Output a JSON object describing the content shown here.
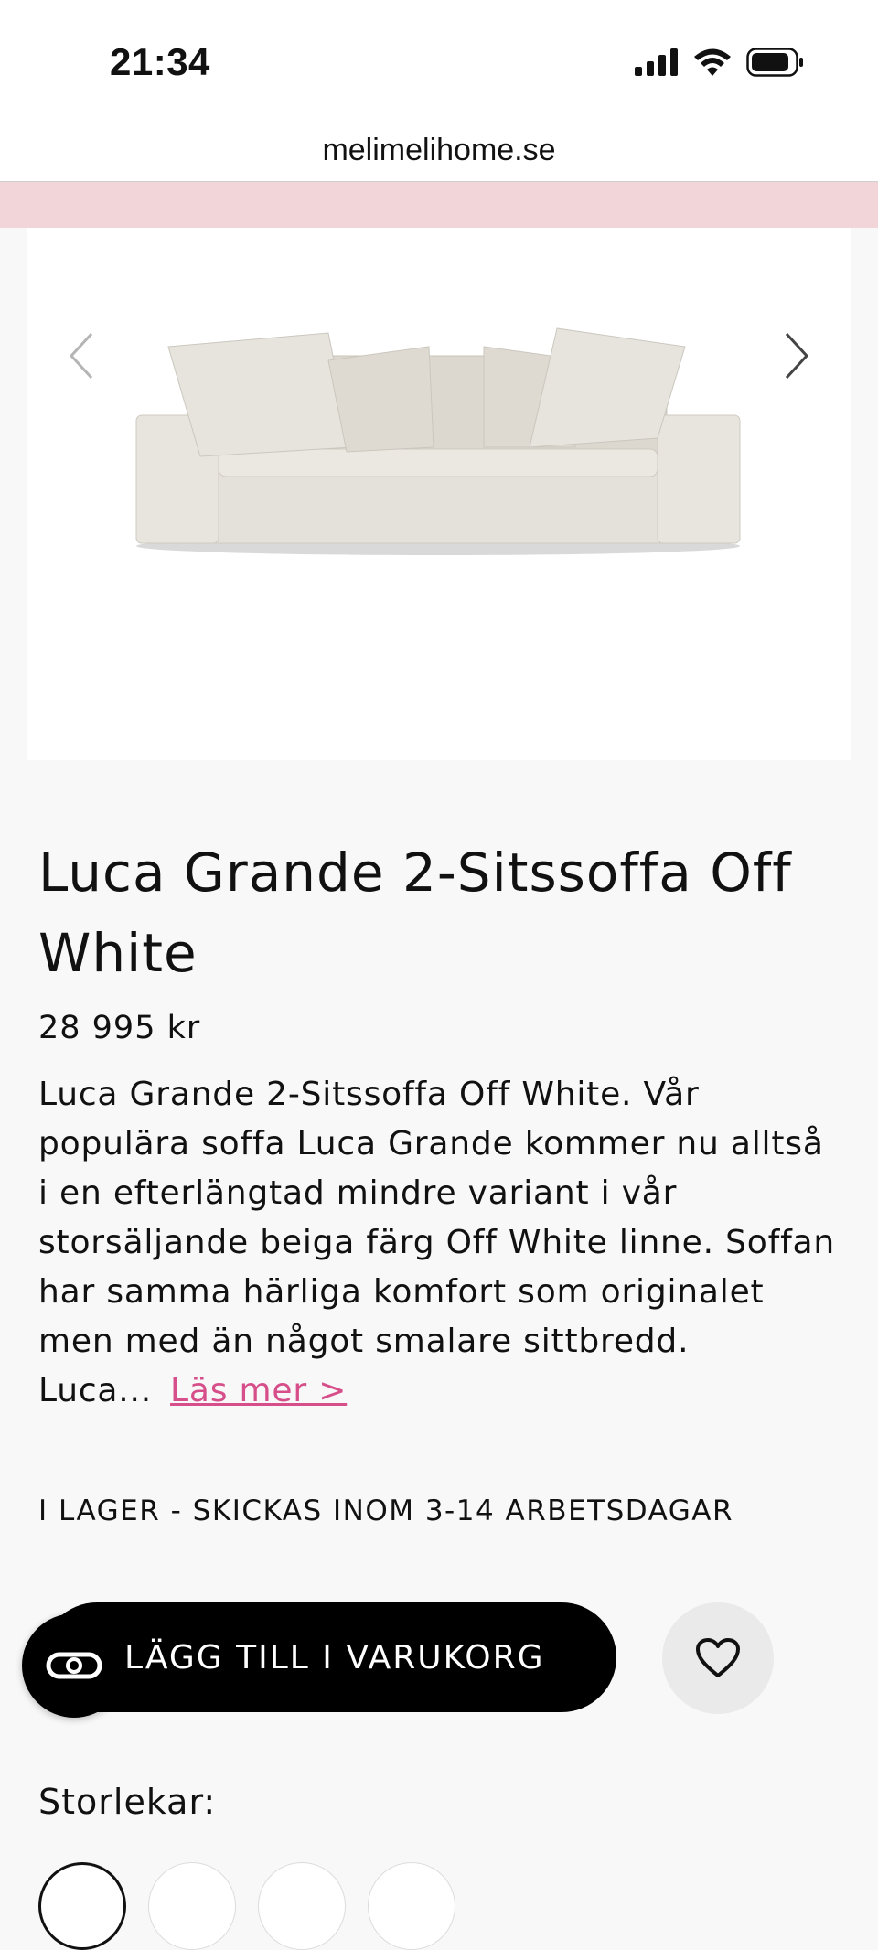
{
  "status_bar": {
    "time": "21:34",
    "icons": [
      "signal-icon",
      "wifi-icon",
      "battery-icon"
    ]
  },
  "browser": {
    "url": "melimelihome.se"
  },
  "colors": {
    "promo_bar": "#f1d5d8",
    "accent_link": "#d64f8a",
    "cart_button": "#000000"
  },
  "gallery": {
    "prev_icon": "chevron-left-icon",
    "next_icon": "chevron-right-icon",
    "image": "sofa-image"
  },
  "product": {
    "title": "Luca Grande 2-Sitssoffa Off White",
    "price": "28 995 kr",
    "description": "Luca Grande 2-Sitssoffa Off White. Vår populära soffa Luca Grande kommer nu alltså i en efterlängtad mindre variant i vår storsäljande beiga färg Off White linne. Soffan har samma härliga komfort som originalet men med än något smalare sittbredd. Luca...",
    "read_more": "Läs mer >",
    "stock_status": "I LAGER - SKICKAS INOM 3-14 ARBETSDAGAR"
  },
  "actions": {
    "add_to_cart": "LÄGG TILL I VARUKORG",
    "wishlist_icon": "heart-icon",
    "chat_icon": "chat-icon"
  },
  "sizes": {
    "label": "Storlekar:",
    "swatch_count": 4
  }
}
